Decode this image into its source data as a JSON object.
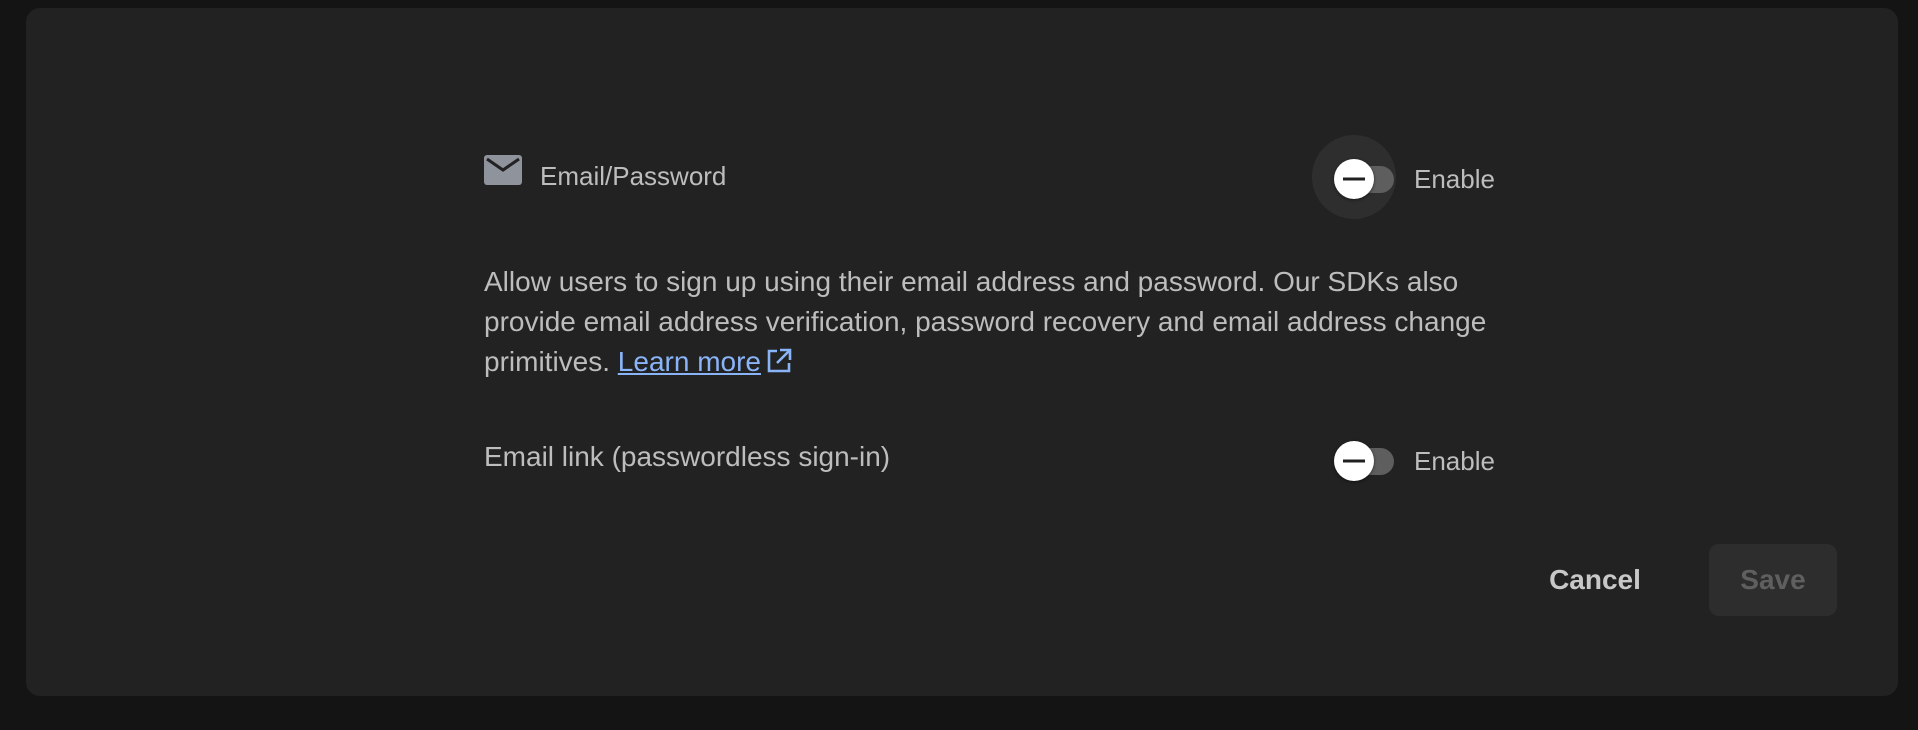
{
  "providers": {
    "email_password": {
      "icon": "mail-icon",
      "label": "Email/Password",
      "toggle_label": "Enable",
      "enabled": false
    },
    "email_link": {
      "label": "Email link (passwordless sign-in)",
      "toggle_label": "Enable",
      "enabled": false
    }
  },
  "description": {
    "text": "Allow users to sign up using their email address and password. Our SDKs also provide email address verification, password recovery and email address change primitives.",
    "link_text": "Learn more",
    "link_icon": "external-link-icon"
  },
  "actions": {
    "cancel_label": "Cancel",
    "save_label": "Save",
    "save_disabled": true
  },
  "colors": {
    "background": "#141414",
    "panel": "#222222",
    "text": "#bdbdbd",
    "link": "#8ab4f8",
    "toggle_track": "#5e5e5e",
    "toggle_thumb": "#ffffff"
  }
}
